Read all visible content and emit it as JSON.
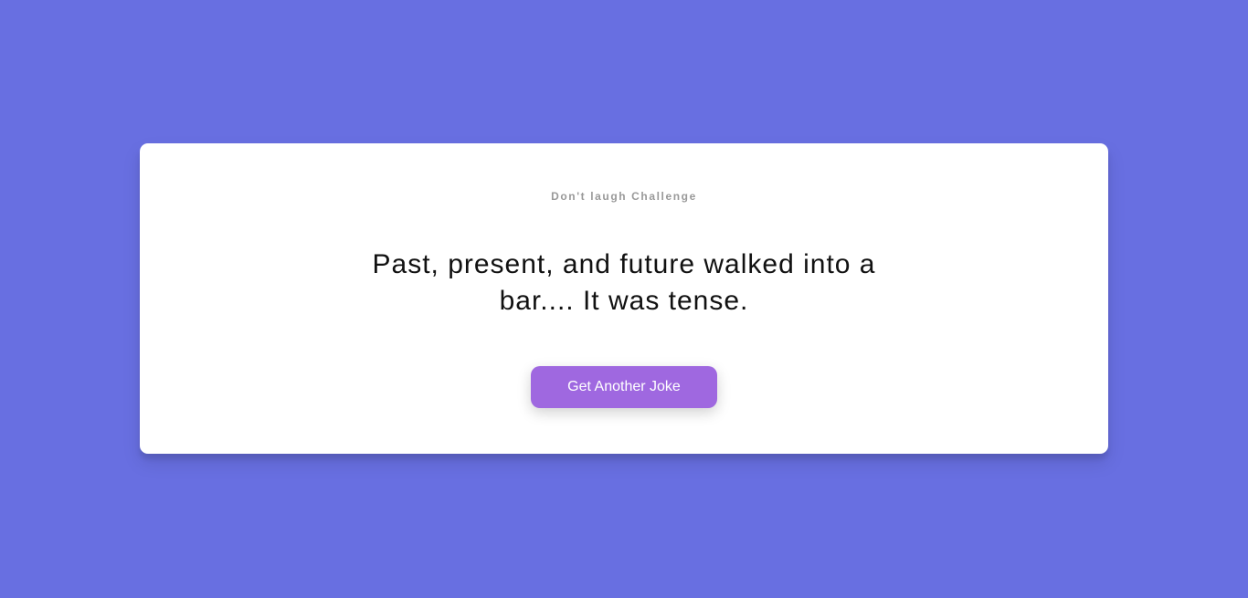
{
  "card": {
    "subtitle": "Don't laugh Challenge",
    "joke": "Past, present, and future walked into a bar.... It was tense.",
    "button_label": "Get Another Joke"
  },
  "colors": {
    "background": "#686fe1",
    "card": "#ffffff",
    "button": "#9f68e0",
    "subtitle": "#999999",
    "joke_text": "#111111"
  }
}
